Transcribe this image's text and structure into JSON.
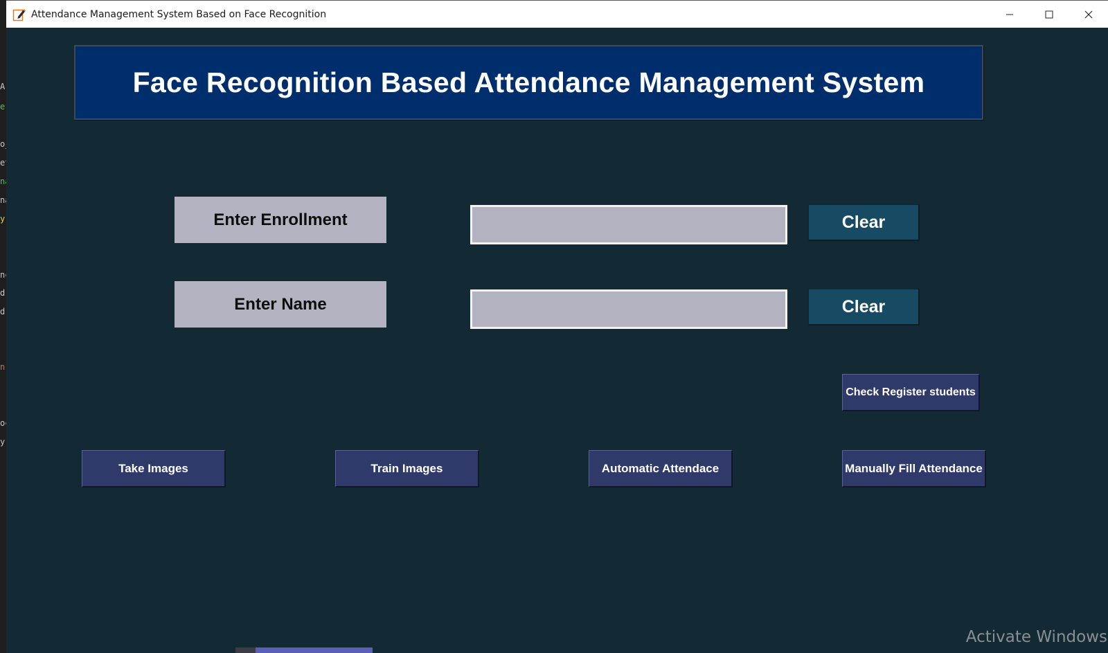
{
  "window": {
    "title": "Attendance Management System Based on Face Recognition",
    "controls": [
      "minimize-icon",
      "maximize-icon",
      "close-icon"
    ]
  },
  "header": {
    "title": "Face Recognition Based Attendance Management System"
  },
  "form": {
    "enrollment_label": "Enter Enrollment",
    "enrollment_value": "",
    "name_label": "Enter Name",
    "name_value": "",
    "clear_enrollment_label": "Clear",
    "clear_name_label": "Clear"
  },
  "actions": {
    "check_register": "Check Register students",
    "take_images": "Take Images",
    "train_images": "Train Images",
    "automatic_attendance": "Automatic Attendace",
    "manual_attendance": "Manually Fill Attendance"
  },
  "system": {
    "watermark": "Activate Windows"
  },
  "background_editor": {
    "fragments": [
      "A",
      "e",
      "o_",
      "et",
      "na",
      "na",
      "y",
      "nc",
      "d",
      "d",
      "n",
      "oc",
      "y"
    ]
  },
  "colors": {
    "window_bg": "#132933",
    "header_bg": "#002d6b",
    "label_bg": "#b4b3c1",
    "input_bg": "#b3b2c0",
    "clear_btn_bg": "#174b63",
    "action_btn_bg": "#2f3a6b"
  }
}
